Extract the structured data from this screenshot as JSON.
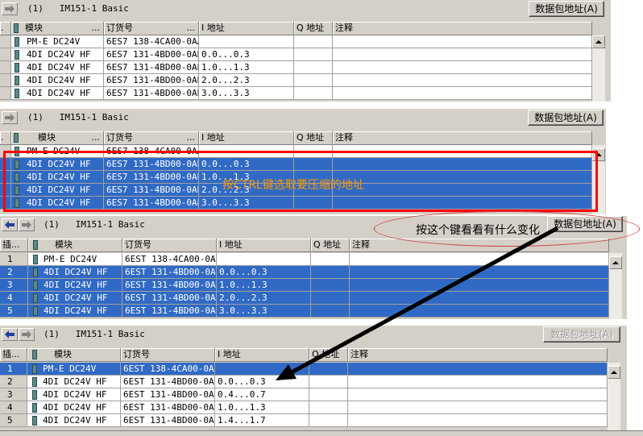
{
  "station_label": "(1)   IM151-1 Basic",
  "pkg_button": "数据包地址(A)",
  "columns": {
    "slot": "插...",
    "module": "模块",
    "order": "订货号",
    "i_addr": "I 地址",
    "q_addr": "Q 地址",
    "comment": "注释",
    "dots": "..."
  },
  "panel1": {
    "rows": [
      {
        "slot": "",
        "module": "PM-E DC24V",
        "order": "6ES7 138-4CA00-0AA0",
        "i_addr": "",
        "sel": false
      },
      {
        "slot": "",
        "module": "4DI DC24V HF",
        "order": "6ES7 131-4BD00-0AB0",
        "i_addr": "0.0...0.3",
        "sel": false
      },
      {
        "slot": "",
        "module": "4DI DC24V HF",
        "order": "6ES7 131-4BD00-0AB0",
        "i_addr": "1.0...1.3",
        "sel": false
      },
      {
        "slot": "",
        "module": "4DI DC24V HF",
        "order": "6ES7 131-4BD00-0AB0",
        "i_addr": "2.0...2.3",
        "sel": false
      },
      {
        "slot": "",
        "module": "4DI DC24V HF",
        "order": "6ES7 131-4BD00-0AB0",
        "i_addr": "3.0...3.3",
        "sel": false
      }
    ]
  },
  "panel2": {
    "rows": [
      {
        "slot": "",
        "module": "PM-E DC24V",
        "order": "6ES7 138-4CA00-0AA0",
        "i_addr": "",
        "sel": false
      },
      {
        "slot": "",
        "module": "4DI DC24V HF",
        "order": "6ES7 131-4BD00-0AB0",
        "i_addr": "0.0...0.3",
        "sel": true
      },
      {
        "slot": "",
        "module": "4DI DC24V HF",
        "order": "6ES7 131-4BD00-0AB0",
        "i_addr": "1.0...1.3",
        "sel": true
      },
      {
        "slot": "",
        "module": "4DI DC24V HF",
        "order": "6ES7 131-4BD00-0AB0",
        "i_addr": "2.0...2.3",
        "sel": true
      },
      {
        "slot": "",
        "module": "4DI DC24V HF",
        "order": "6ES7 131-4BD00-0AB0",
        "i_addr": "3.0...3.3",
        "sel": true
      }
    ],
    "annotation": "按CTRL键选取要压缩的地址"
  },
  "panel3": {
    "rows": [
      {
        "slot": "1",
        "module": "PM-E DC24V",
        "order": "6EST 138-4CA00-0AA0",
        "i_addr": "",
        "sel": false
      },
      {
        "slot": "2",
        "module": "4DI DC24V HF",
        "order": "6EST 131-4BD00-0AB0",
        "i_addr": "0.0...0.3",
        "sel": true
      },
      {
        "slot": "3",
        "module": "4DI DC24V HF",
        "order": "6EST 131-4BD00-0AB0",
        "i_addr": "1.0...1.3",
        "sel": true
      },
      {
        "slot": "4",
        "module": "4DI DC24V HF",
        "order": "6EST 131-4BD00-0AB0",
        "i_addr": "2.0...2.3",
        "sel": true
      },
      {
        "slot": "5",
        "module": "4DI DC24V HF",
        "order": "6EST 131-4BD00-0AB0",
        "i_addr": "3.0...3.3",
        "sel": true
      }
    ],
    "annotation": "按这个键看看有什么变化"
  },
  "panel4": {
    "rows": [
      {
        "slot": "1",
        "module": "PM-E DC24V",
        "order": "6EST 138-4CA00-0AA0",
        "i_addr": "",
        "sel": true
      },
      {
        "slot": "2",
        "module": "4DI DC24V HF",
        "order": "6EST 131-4BD00-0AB0",
        "i_addr": "0.0...0.3",
        "sel": false
      },
      {
        "slot": "3",
        "module": "4DI DC24V HF",
        "order": "6EST 131-4BD00-0AB0",
        "i_addr": "0.4...0.7",
        "sel": false
      },
      {
        "slot": "4",
        "module": "4DI DC24V HF",
        "order": "6EST 131-4BD00-0AB0",
        "i_addr": "1.0...1.3",
        "sel": false
      },
      {
        "slot": "5",
        "module": "4DI DC24V HF",
        "order": "6EST 131-4BD00-0AB0",
        "i_addr": "1.4...1.7",
        "sel": false
      }
    ]
  },
  "colors": {
    "selection": "#316ac5",
    "annotation_red": "#ff0000",
    "annotation_orange": "#ff9900"
  }
}
